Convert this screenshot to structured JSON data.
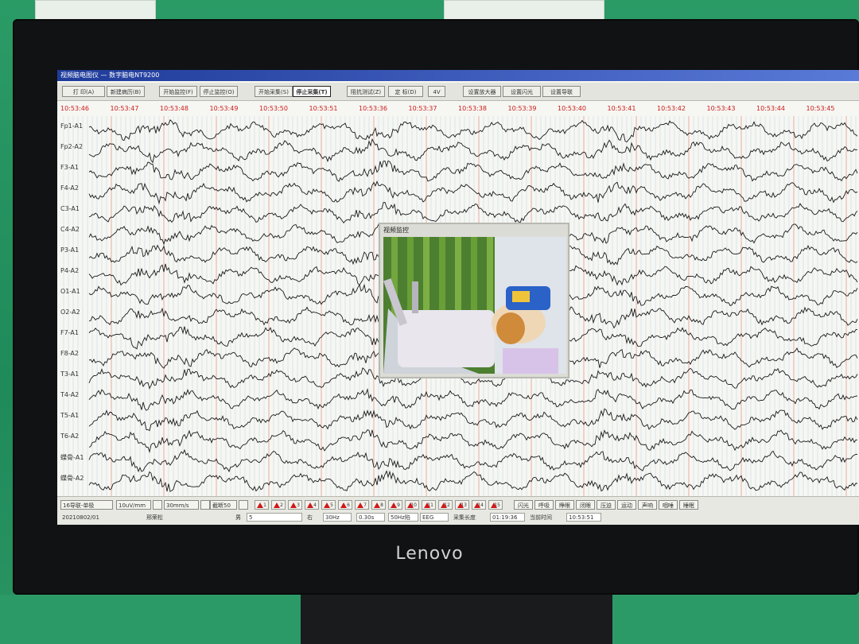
{
  "window": {
    "title": "视频脑电图仪 — 数字脑电NT9200"
  },
  "toolbar": {
    "buttons": [
      "打  印(A)",
      "新建病历(B)",
      "开始监控(F)",
      "停止监控(O)",
      "开始采集(S)",
      "停止采集(T)",
      "阻抗测试(Z)",
      "定  标(D)",
      "4V",
      "设置放大器",
      "设置闪光",
      "设置导联"
    ]
  },
  "timeline": {
    "labels": [
      "10:53:46",
      "10:53:47",
      "10:53:48",
      "10:53:49",
      "10:53:50",
      "10:53:51",
      "10:53:36",
      "10:53:37",
      "10:53:38",
      "10:53:39",
      "10:53:40",
      "10:53:41",
      "10:53:42",
      "10:53:43",
      "10:53:44",
      "10:53:45"
    ]
  },
  "channels": [
    "Fp1-A1",
    "Fp2-A2",
    "F3-A1",
    "F4-A2",
    "C3-A1",
    "C4-A2",
    "P3-A1",
    "P4-A2",
    "O1-A1",
    "O2-A2",
    "F7-A1",
    "F8-A2",
    "T3-A1",
    "T4-A2",
    "T5-A1",
    "T6-A2",
    "蝶骨-A1",
    "蝶骨-A2"
  ],
  "video_panel": {
    "title": "视频监控"
  },
  "bottom": {
    "montage": "16导联-单极",
    "sensitivity": "10uV/mm",
    "speed": "30mm/s",
    "filter": "截断50",
    "markers": [
      "1",
      "2",
      "3",
      "4",
      "5",
      "6",
      "7",
      "8",
      "9",
      "10",
      "11",
      "12",
      "13",
      "14",
      "15"
    ],
    "stim_buttons": [
      "闪光",
      "呼吸",
      "睁眼",
      "闭眼",
      "压迫",
      "运动",
      "声响",
      "咽唾",
      "睡眠"
    ],
    "status_labels": [
      "20210802/01",
      "邢荣松",
      "男",
      "5",
      "右",
      "30Hz",
      "0.30s",
      "50Hz陷",
      "EEG",
      "采集长度",
      "01:19:36",
      "当前时间",
      "10:53:51"
    ]
  },
  "colors": {
    "trace": "#1a1a1a",
    "grid_red": "#e06a6a",
    "grid_blue": "#8aa6d8",
    "time_label": "#cc1a1a"
  },
  "brand": "Lenovo"
}
